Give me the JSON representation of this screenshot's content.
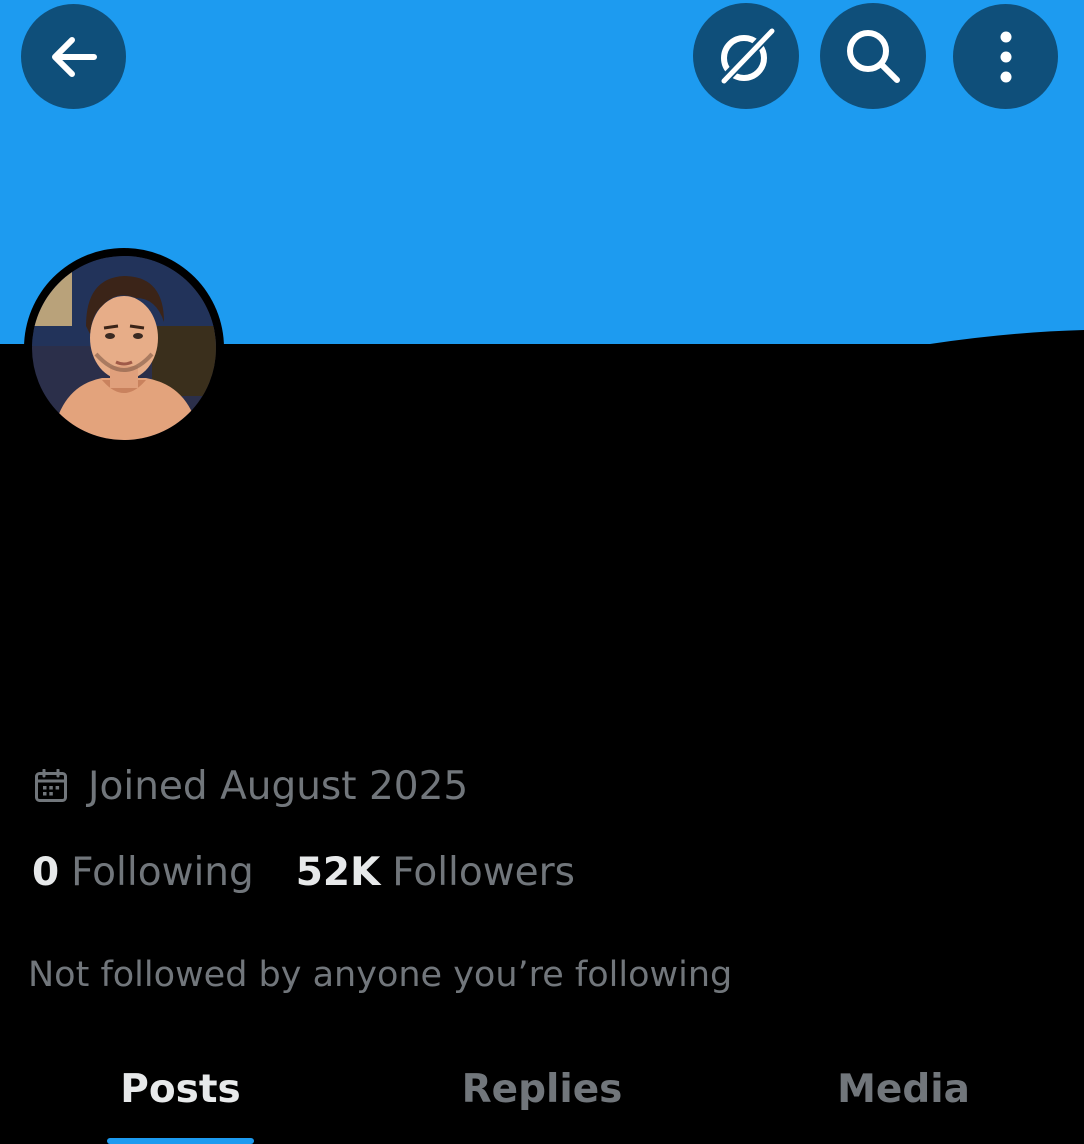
{
  "colors": {
    "banner": "#1d9bf0",
    "icon_button_bg": "#0f4f7a",
    "background": "#000000",
    "text_primary": "#e7e9ea",
    "text_secondary": "#71767b",
    "accent": "#1d9bf0"
  },
  "header": {
    "back_icon": "arrow-left-icon",
    "grok_icon": "grok-icon",
    "search_icon": "search-icon",
    "more_icon": "more-vertical-icon"
  },
  "profile": {
    "avatar": "profile-avatar",
    "joined_icon": "calendar-icon",
    "joined_text": "Joined August 2025",
    "following_count": "0",
    "following_label": "Following",
    "followers_count": "52K",
    "followers_label": "Followers",
    "mutuals_text": "Not followed by anyone you’re following"
  },
  "tabs": [
    {
      "label": "Posts",
      "active": true
    },
    {
      "label": "Replies",
      "active": false
    },
    {
      "label": "Media",
      "active": false
    }
  ]
}
